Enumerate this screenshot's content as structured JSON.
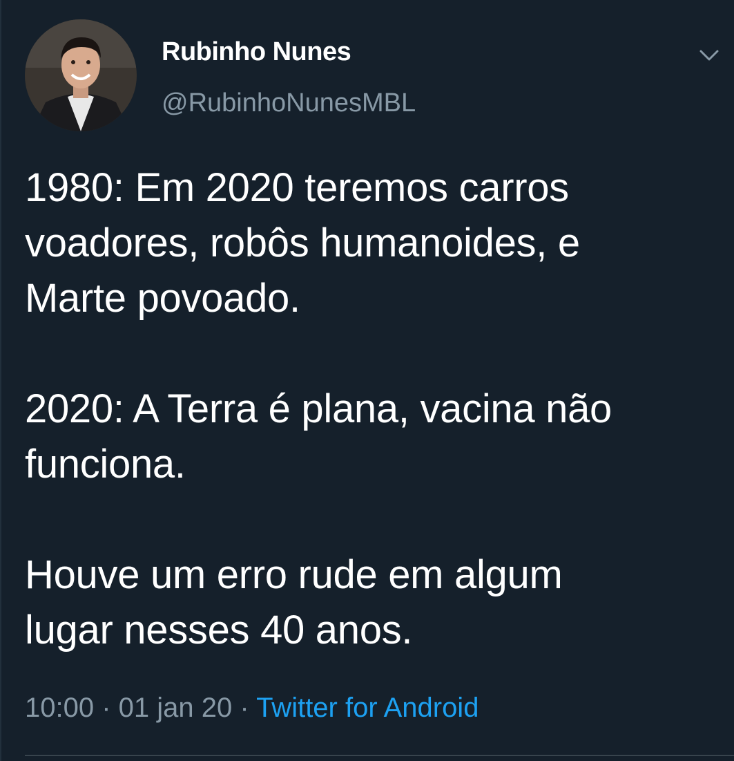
{
  "tweet": {
    "author": {
      "display_name": "Rubinho Nunes",
      "handle": "@RubinhoNunesMBL"
    },
    "text": {
      "line1": "1980: Em 2020 teremos carros",
      "line2": "voadores, robôs humanoides, e",
      "line3": "Marte povoado.",
      "line4": "2020: A Terra é plana, vacina não",
      "line5": "funciona.",
      "line6": "Houve um erro rude em algum",
      "line7": "lugar nesses 40 anos."
    },
    "meta": {
      "time": "10:00",
      "separator": " · ",
      "date": "01 jan 20",
      "source": "Twitter for Android"
    },
    "icons": {
      "menu": "chevron-down-icon"
    },
    "colors": {
      "background": "#15202b",
      "text": "#ffffff",
      "muted": "#8899a6",
      "link": "#1da1f2"
    }
  }
}
